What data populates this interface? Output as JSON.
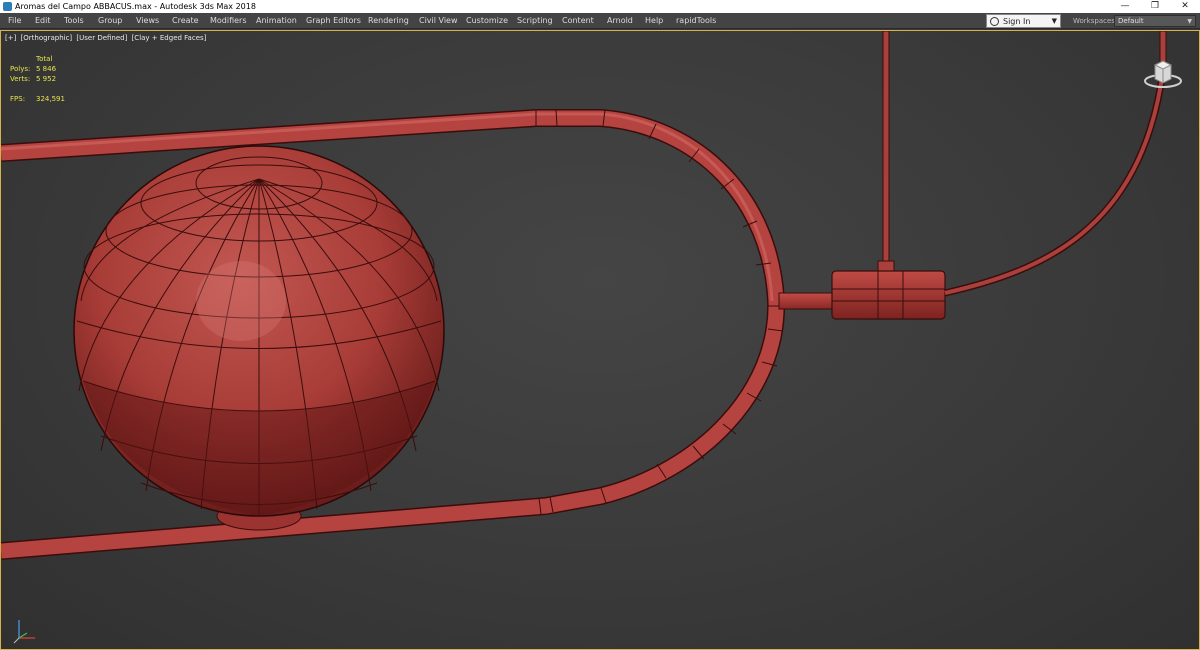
{
  "window": {
    "title": "Aromas del Campo ABBACUS.max - Autodesk 3ds Max 2018",
    "controls": {
      "minimize": "—",
      "maximize": "❐",
      "close": "✕"
    }
  },
  "menubar": {
    "items": [
      "File",
      "Edit",
      "Tools",
      "Group",
      "Views",
      "Create",
      "Modifiers",
      "Animation",
      "Graph Editors",
      "Rendering",
      "Civil View",
      "Customize",
      "Scripting",
      "Content",
      "Arnold",
      "Help",
      "rapidTools"
    ],
    "sign_in": "Sign In",
    "workspaces_label": "Workspaces:",
    "workspace_value": "Default"
  },
  "viewport": {
    "labels": [
      "[+]",
      "[Orthographic]",
      "[User Defined]",
      "[Clay + Edged Faces]"
    ],
    "stats": {
      "header": "Total",
      "polys_label": "Polys:",
      "polys_value": "5 846",
      "verts_label": "Verts:",
      "verts_value": "5 952",
      "fps_label": "FPS:",
      "fps_value": "324,591"
    }
  },
  "icons": {
    "app": "3ds-max-app-icon",
    "user": "user-icon",
    "viewcube": "viewcube-icon",
    "axis": "axis-tripod-icon"
  },
  "colors": {
    "clay": "#b5433f",
    "edge": "#3a0d0c",
    "viewport_border": "#d4b44a",
    "stats_text": "#e6e64a"
  }
}
